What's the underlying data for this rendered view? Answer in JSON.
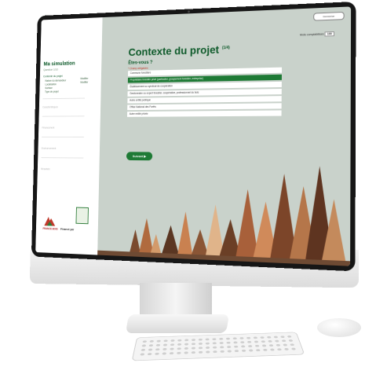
{
  "top": {
    "login_label": "Connexion"
  },
  "sidebar": {
    "title": "Ma simulation",
    "subtitle": "Question 1/10",
    "section": "Contexte du projet",
    "items": [
      "Nature du demandeur",
      "Localisation",
      "Surface",
      "Type de projet"
    ],
    "right_items": [
      "Modifier",
      "Modifier"
    ],
    "locked": [
      "Caractéristiques",
      "Financement",
      "Environnement",
      "Résultats"
    ],
    "partner_label": "FRANCE BOIS",
    "financed_label": "Financé par"
  },
  "main": {
    "title": "Contexte du projet",
    "title_step": "(1/4)",
    "question": "Êtes-vous ?",
    "required_note": "* Champ obligatoire",
    "counter_label": "Mots comptabilisés",
    "counter_value": "100",
    "options": [
      "Commune forestière",
      "Propriétaire forestier privé (particulier, groupement forestier, entreprise)",
      "Établissement ou syndicat de coopération",
      "Gestionnaire ou expert forestier, coopérative, professionnel du bois",
      "Autre entité publique",
      "Office National des Forêts",
      "Autre entité privée"
    ],
    "selected_index": 1,
    "next_label": "Suivant ▶"
  },
  "colors": {
    "brand": "#1e7a35",
    "title": "#0e5a2a",
    "screen_bg": "#c9d2cb"
  }
}
